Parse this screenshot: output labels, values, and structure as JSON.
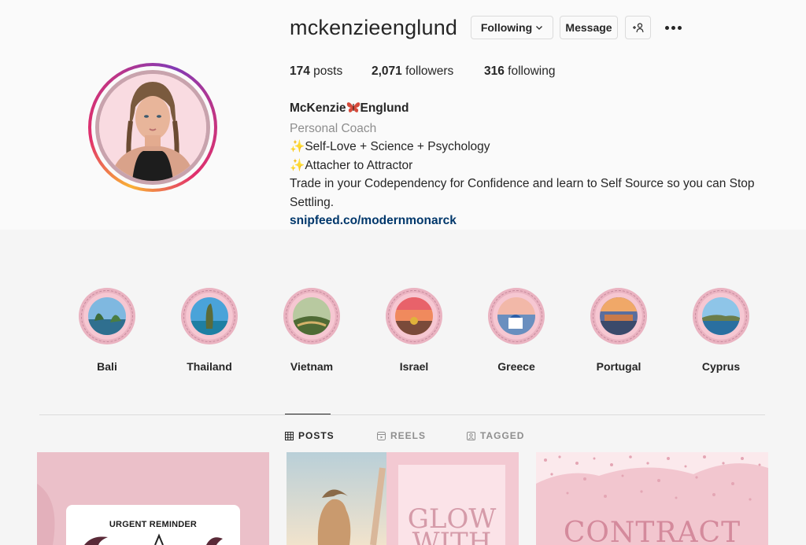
{
  "profile": {
    "username": "mckenzieenglund",
    "buttons": {
      "following": "Following",
      "message": "Message"
    },
    "stats": {
      "posts_count": "174",
      "posts_label": " posts",
      "followers_count": "2,071",
      "followers_label": " followers",
      "following_count": "316",
      "following_label": " following"
    },
    "bio": {
      "name_first": "McKenzie",
      "name_last": "Englund",
      "category": "Personal Coach",
      "line1": "Self-Love + Science + Psychology",
      "line2": "Attacher to Attractor",
      "line3": "Trade in your Codependency for Confidence and learn to Self Source so you can Stop Settling.",
      "link": "snipfeed.co/modernmonarck"
    }
  },
  "highlights": [
    {
      "label": "Bali"
    },
    {
      "label": "Thailand"
    },
    {
      "label": "Vietnam"
    },
    {
      "label": "Israel"
    },
    {
      "label": "Greece"
    },
    {
      "label": "Portugal"
    },
    {
      "label": "Cyprus"
    }
  ],
  "tabs": [
    {
      "label": "POSTS",
      "active": true
    },
    {
      "label": "REELS",
      "active": false
    },
    {
      "label": "TAGGED",
      "active": false
    }
  ],
  "posts": [
    {
      "text": "URGENT REMINDER"
    },
    {
      "text": "GLOW WITH"
    },
    {
      "text": "CONTRACT"
    }
  ],
  "colors": {
    "accent_link": "#00376b",
    "highlight_ring": "#f6c7d2",
    "post_pink": "#f2c6cf"
  }
}
